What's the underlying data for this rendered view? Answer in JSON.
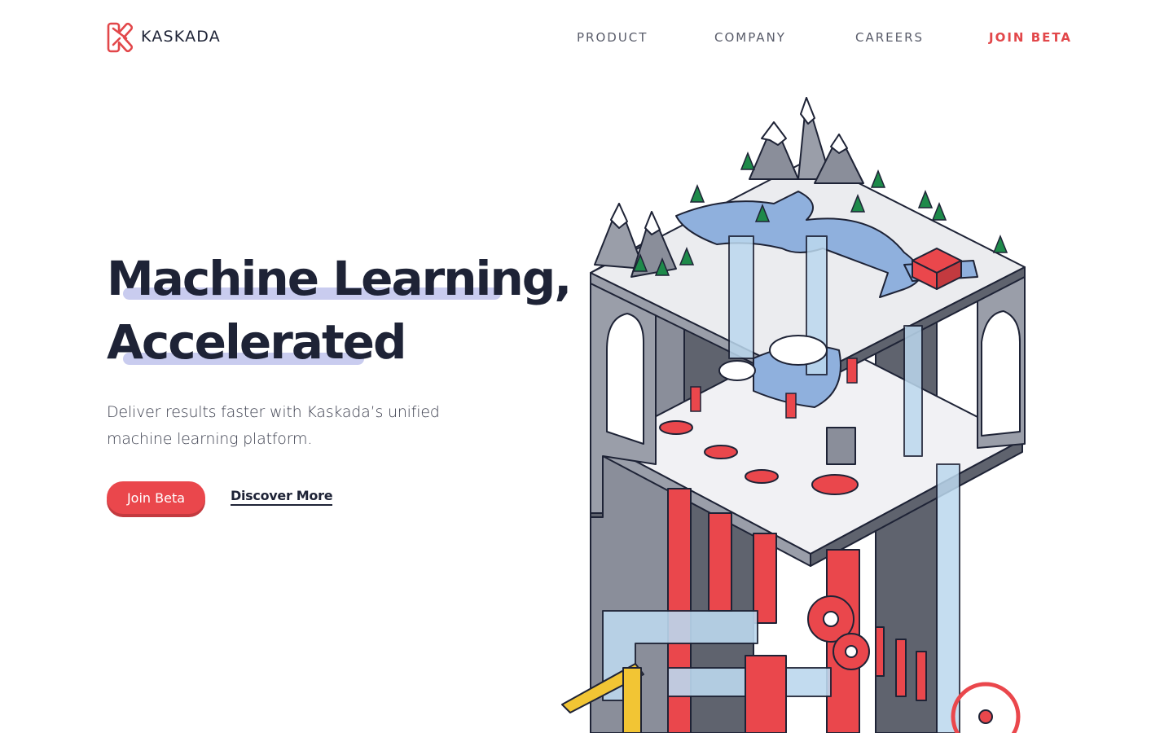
{
  "brand": {
    "name": "KASKADA",
    "logo_icon": "kaskada-k-logo",
    "accent_color": "#ea474c",
    "text_color": "#1e2336"
  },
  "nav": {
    "items": [
      {
        "label": "PRODUCT"
      },
      {
        "label": "COMPANY"
      },
      {
        "label": "CAREERS"
      },
      {
        "label": "JOIN BETA"
      }
    ]
  },
  "hero": {
    "title_line1": "Machine Learning,",
    "title_line2": "Accelerated",
    "subtitle_line1": "Deliver results faster with Kaskada’s unified",
    "subtitle_line2": "machine learning platform.",
    "primary_button": "Join Beta",
    "secondary_link": "Discover More",
    "highlight_color": "#c9ccef"
  },
  "illustration": {
    "icon": "isometric-data-factory-illustration"
  }
}
